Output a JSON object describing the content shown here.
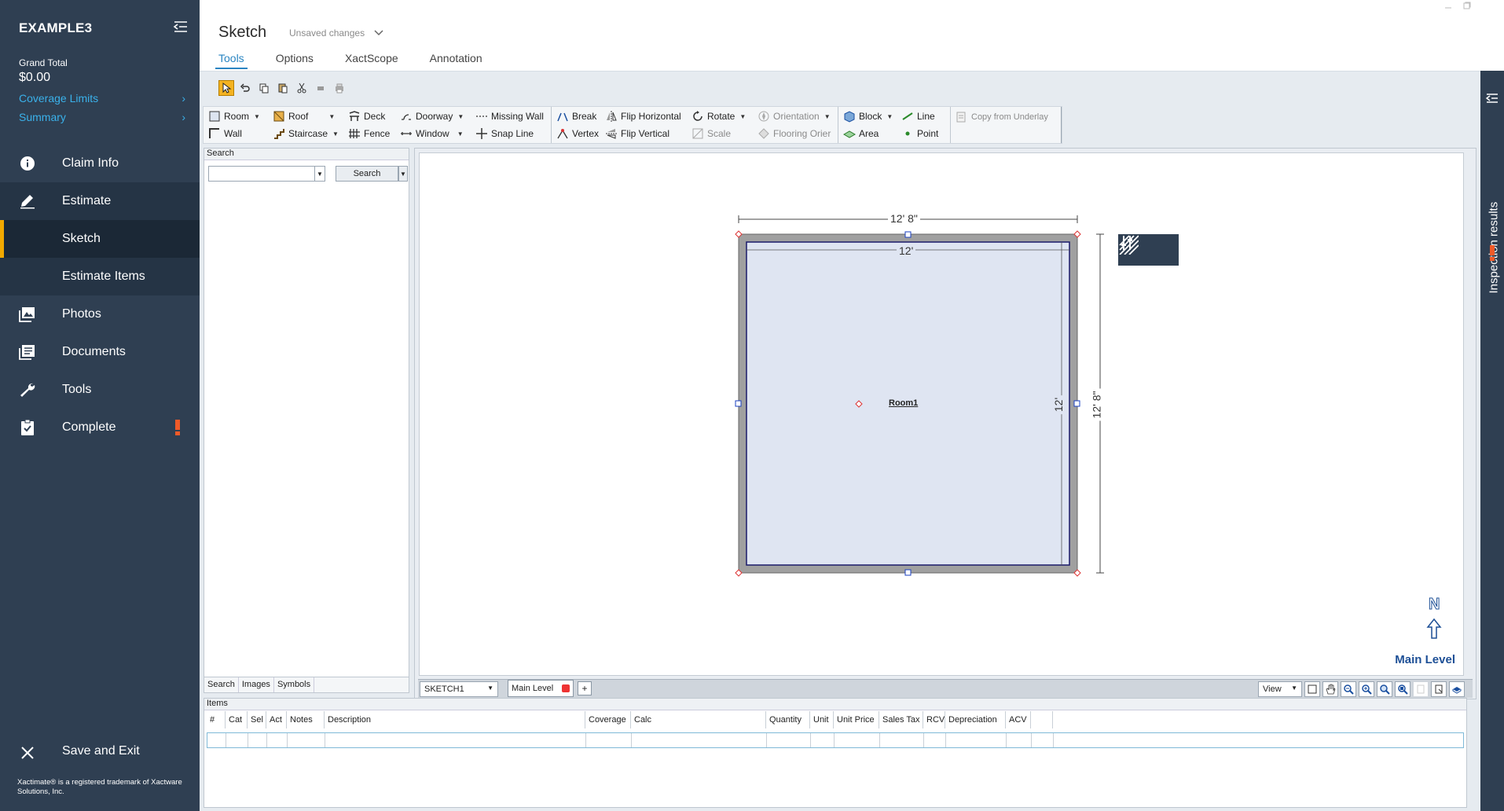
{
  "sidebar": {
    "title": "EXAMPLE3",
    "grand_total_label": "Grand Total",
    "grand_total_value": "$0.00",
    "links": [
      {
        "label": "Coverage Limits"
      },
      {
        "label": "Summary"
      }
    ],
    "nav": {
      "claim_info": "Claim Info",
      "estimate": "Estimate",
      "sketch": "Sketch",
      "estimate_items": "Estimate Items",
      "photos": "Photos",
      "documents": "Documents",
      "tools": "Tools",
      "complete": "Complete"
    },
    "save_exit": "Save and Exit",
    "trademark": "Xactimate® is a registered trademark of Xactware Solutions, Inc.",
    "alert_color": "#f05a28"
  },
  "header": {
    "title": "Sketch",
    "status": "Unsaved changes",
    "tabs": [
      "Tools",
      "Options",
      "XactScope",
      "Annotation"
    ],
    "active_tab": "Tools"
  },
  "ribbon": {
    "group1": {
      "col1": [
        "Room",
        "Wall"
      ],
      "col2": [
        "Roof",
        "Staircase"
      ],
      "col3": [
        "Deck",
        "Fence"
      ],
      "col4": [
        "Doorway",
        "Window"
      ],
      "col5": [
        "Missing Wall",
        "Snap Line"
      ]
    },
    "group2": {
      "col1": [
        "Break",
        "Vertex"
      ],
      "col2": [
        "Flip Horizontal",
        "Flip Vertical"
      ],
      "col3": [
        "Rotate",
        "Scale"
      ],
      "col4": [
        "Orientation",
        "Flooring Orier"
      ]
    },
    "group3": {
      "col1": [
        "Block",
        "Area"
      ],
      "col2": [
        "Line",
        "Point"
      ]
    },
    "group4": {
      "col1": [
        "Copy from Underlay"
      ]
    }
  },
  "search_panel": {
    "header": "Search",
    "input_value": "",
    "button_label": "Search",
    "tabs": [
      "Search",
      "Images",
      "Symbols"
    ]
  },
  "canvas": {
    "room_name": "Room1",
    "outer_width_dim": "12' 8\"",
    "inner_width_dim": "12'",
    "inner_height_dim": "12'",
    "outer_height_dim": "12' 8\"",
    "north_label": "N",
    "level_label": "Main Level",
    "sketch_select": "SKETCH1",
    "level_tab": "Main Level",
    "add_level": "+",
    "view_select": "View"
  },
  "items_panel": {
    "header": "Items",
    "columns": [
      "#",
      "Cat",
      "Sel",
      "Act",
      "Notes",
      "Description",
      "Coverage",
      "Calc",
      "Quantity",
      "Unit",
      "Unit Price",
      "Sales Tax",
      "RCV",
      "Depreciation",
      "ACV"
    ]
  },
  "right_rail": {
    "label": "Inspection results"
  }
}
